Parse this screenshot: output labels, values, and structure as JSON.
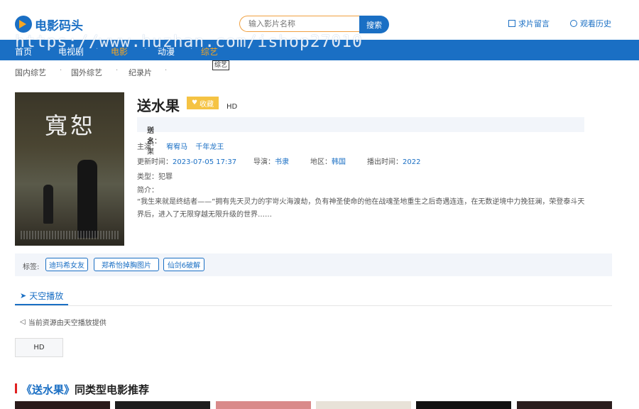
{
  "header": {
    "logo_text": "电影码头",
    "search_placeholder": "输入影片名称",
    "search_button": "搜索",
    "link_request": "求片留言",
    "link_history": "观看历史"
  },
  "nav": {
    "items": [
      "首页",
      "电视剧",
      "电影",
      "动漫",
      "综艺"
    ],
    "active": "电影",
    "tooltip": "综艺"
  },
  "watermark": "https://www.huzhan.com/ishop27010",
  "subnav": [
    "国内综艺",
    "国外综艺",
    "纪录片"
  ],
  "movie": {
    "title": "送水果",
    "fav_label": "收藏",
    "quality": "HD",
    "alias_label": "别名：",
    "alias": "送水果",
    "cast_label": "主演：",
    "cast": [
      "宥宥马",
      "千年龙王"
    ],
    "updated_label": "更新时间：",
    "updated": "2023-07-05 17:37",
    "director_label": "导演：",
    "director": "书隶",
    "region_label": "地区：",
    "region": "韩国",
    "year_label": "播出时间：",
    "year": "2022",
    "genre_label": "类型：",
    "genre": "犯罪",
    "intro_label": "简介：",
    "intro": "“我生来就是终结者——”拥有先天灵力的宇岢火海渡劫，负有神圣使命的他在战魂圣地重生之后奇遇连连，在无数逆境中力挽狂澜，荣登泰斗天界后，进入了无限穿越无限升级的世界……",
    "poster_calligraphy": "寬恕"
  },
  "tags": {
    "label": "标签:",
    "items": [
      "迪玛希女友",
      "郑希怡掉胸图片",
      "仙剑6破解"
    ]
  },
  "play": {
    "tab": "天空播放",
    "source_note": "当前资源由天空播放提供",
    "episode": "HD"
  },
  "recommend": {
    "title_prefix": "《送水果》",
    "title_suffix": "同类型电影推荐"
  },
  "colors": {
    "brand": "#1a6fc4",
    "accent": "#f5a623",
    "fav": "#f5c343",
    "section_bar": "#e02020"
  }
}
